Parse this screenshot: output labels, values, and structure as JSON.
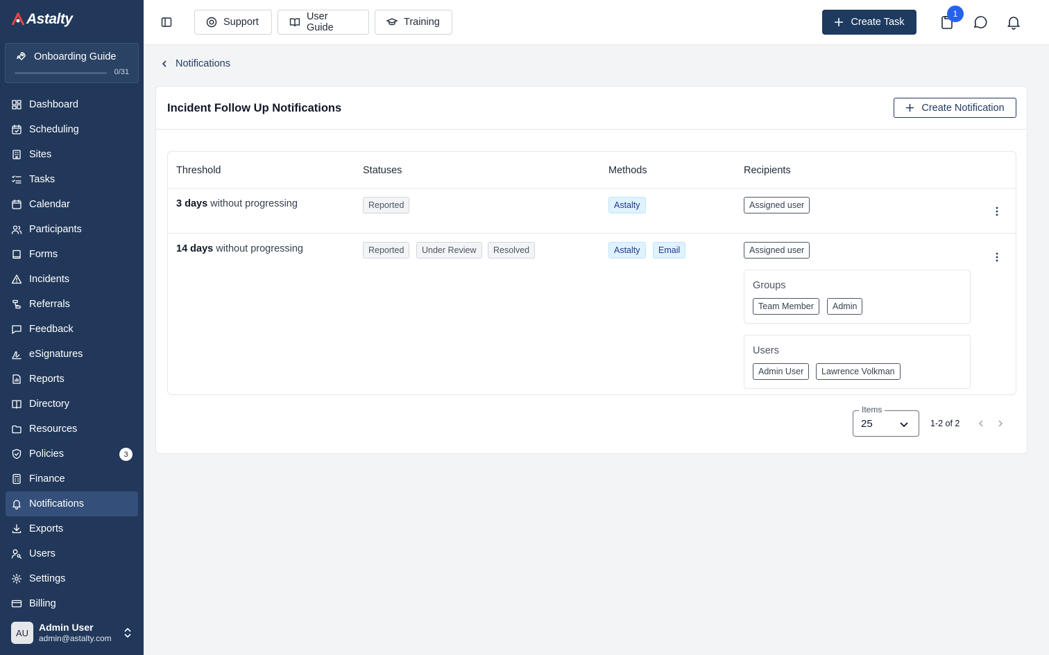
{
  "app": {
    "logo_text": "Astalty"
  },
  "onboarding": {
    "title": "Onboarding Guide",
    "progress_text": "0/31",
    "progress": 0
  },
  "sidebar": {
    "items": [
      {
        "label": "Dashboard",
        "icon": "dashboard-icon"
      },
      {
        "label": "Scheduling",
        "icon": "calendar-check-icon"
      },
      {
        "label": "Sites",
        "icon": "building-icon"
      },
      {
        "label": "Tasks",
        "icon": "list-checks-icon"
      },
      {
        "label": "Calendar",
        "icon": "calendar-icon"
      },
      {
        "label": "Participants",
        "icon": "users-icon"
      },
      {
        "label": "Forms",
        "icon": "book-icon"
      },
      {
        "label": "Incidents",
        "icon": "warning-icon"
      },
      {
        "label": "Referrals",
        "icon": "referral-icon"
      },
      {
        "label": "Feedback",
        "icon": "message-icon"
      },
      {
        "label": "eSignatures",
        "icon": "signature-icon"
      },
      {
        "label": "Reports",
        "icon": "reports-icon"
      },
      {
        "label": "Directory",
        "icon": "directory-icon"
      },
      {
        "label": "Resources",
        "icon": "folder-icon"
      },
      {
        "label": "Policies",
        "icon": "shield-icon",
        "badge": "3"
      },
      {
        "label": "Finance",
        "icon": "calculator-icon"
      },
      {
        "label": "Notifications",
        "icon": "bell-icon",
        "active": true
      },
      {
        "label": "Exports",
        "icon": "download-icon"
      },
      {
        "label": "Users",
        "icon": "user-key-icon"
      },
      {
        "label": "Settings",
        "icon": "gear-icon"
      },
      {
        "label": "Billing",
        "icon": "card-icon"
      }
    ]
  },
  "user": {
    "initials": "AU",
    "name": "Admin User",
    "email": "admin@astalty.com"
  },
  "header": {
    "support_label": "Support",
    "user_guide_label": "User Guide",
    "training_label": "Training",
    "create_task_label": "Create Task",
    "tasks_badge": "1"
  },
  "breadcrumb": {
    "label": "Notifications"
  },
  "card": {
    "title": "Incident Follow Up Notifications",
    "create_label": "Create Notification",
    "columns": [
      "Threshold",
      "Statuses",
      "Methods",
      "Recipients"
    ],
    "rows": [
      {
        "threshold_value": "3 days",
        "threshold_suffix": " without progressing",
        "statuses": [
          "Reported"
        ],
        "methods": [
          "Astalty"
        ],
        "recipients": [
          "Assigned user"
        ]
      },
      {
        "threshold_value": "14 days",
        "threshold_suffix": " without progressing",
        "statuses": [
          "Reported",
          "Under Review",
          "Resolved"
        ],
        "methods": [
          "Astalty",
          "Email"
        ],
        "recipients": [
          "Assigned user"
        ],
        "groups_title": "Groups",
        "groups": [
          "Team Member",
          "Admin"
        ],
        "users_title": "Users",
        "users": [
          "Admin User",
          "Lawrence Volkman"
        ]
      }
    ]
  },
  "pagination": {
    "items_label": "Items",
    "items_value": "25",
    "range": "1-2 of 2"
  },
  "colors": {
    "sidebar": "#21385a",
    "accent": "#1e3a5f",
    "badge": "#2563eb"
  }
}
